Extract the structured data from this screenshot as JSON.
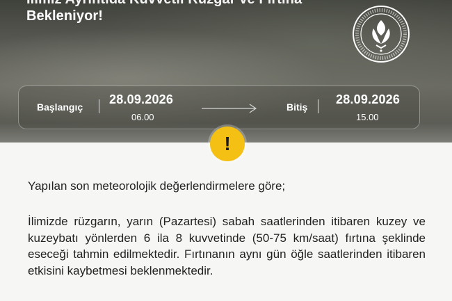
{
  "header": {
    "title_line_1": "İlimiz Ayrıntıda Kuvvetli Rüzgâr ve Fırtına",
    "title_line_2": "Bekleniyor!",
    "logo_name": "governorship-seal"
  },
  "date_range": {
    "start_label": "Başlangıç",
    "start_date": "28.09.2026",
    "start_time": "06.00",
    "end_label": "Bitiş",
    "end_date": "28.09.2026",
    "end_time": "15.00"
  },
  "alert": {
    "icon": "exclamation-icon",
    "symbol": "!",
    "color": "#f4c013"
  },
  "content": {
    "paragraph_1": "Yapılan son meteorolojik değerlendirmelere göre;",
    "paragraph_2": "İlimizde rüzgarın, yarın (Pazartesi) sabah saatlerinden itibaren kuzey ve kuzeybatı yönlerden 6 ila 8 kuvvetinde (50-75 km/saat) fırtına şeklinde eseceği tahmin edilmektedir. Fırtınanın aynı gün öğle saatlerinden itibaren etkisini kaybetmesi beklenmektedir."
  }
}
